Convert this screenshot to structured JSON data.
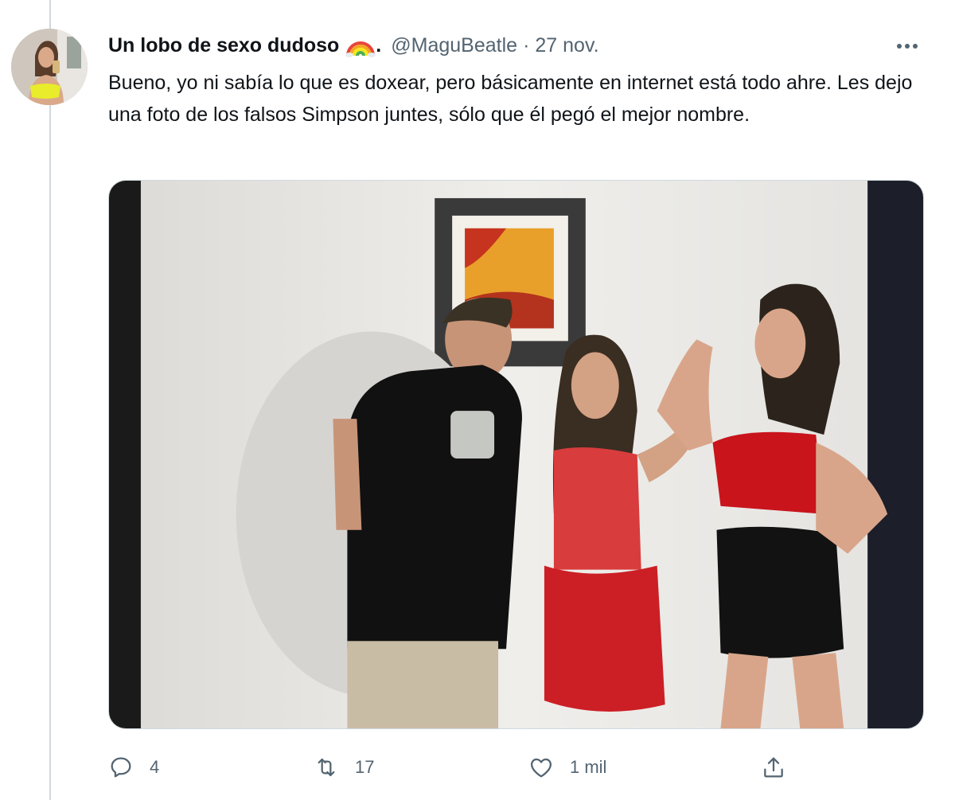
{
  "tweet": {
    "author_name": "Un lobo de sexo dudoso",
    "author_emoji": "rainbow-emoji",
    "name_suffix": ".",
    "handle": "@MaguBeatle",
    "separator": "·",
    "date": "27 nov.",
    "text": "Bueno, yo ni sabía lo que es doxear, pero básicamente en internet está todo ahre. Les dejo una foto de los falsos Simpson juntes, sólo que él pegó el mejor nombre.",
    "media_description_icon": "photo",
    "stats": {
      "replies": "4",
      "retweets": "17",
      "likes": "1 mil"
    }
  },
  "icons": {
    "more": "more-horizontal-icon",
    "reply": "reply-icon",
    "retweet": "retweet-icon",
    "like": "heart-icon",
    "share": "share-icon"
  },
  "colors": {
    "text": "#0f1419",
    "secondary": "#536471",
    "border": "#cfd9de"
  }
}
